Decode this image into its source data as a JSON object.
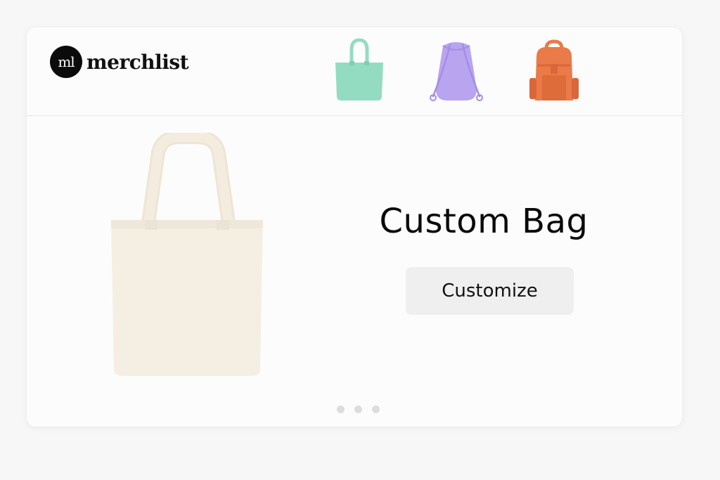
{
  "brand": {
    "mark": "ml",
    "name": "merchlist"
  },
  "product_thumbnails": [
    {
      "icon": "tote-bag-icon",
      "color": "#93dcc2"
    },
    {
      "icon": "drawstring-bag-icon",
      "color": "#b9a4f0"
    },
    {
      "icon": "backpack-icon",
      "color": "#ea7a47"
    }
  ],
  "hero": {
    "image": "tote-bag-image",
    "image_color": "#f5efe3",
    "title": "Custom Bag",
    "cta_label": "Customize"
  },
  "carousel": {
    "page_count": 3
  },
  "colors": {
    "background": "#f7f7f7",
    "card": "#fcfcfc",
    "button": "#efefef"
  }
}
